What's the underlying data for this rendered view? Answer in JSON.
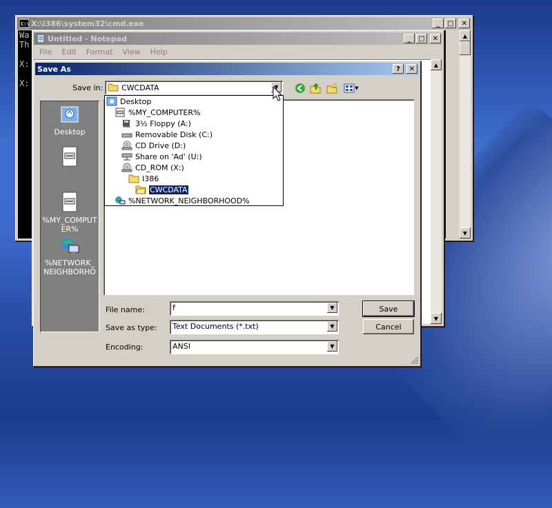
{
  "cmd": {
    "title": "X:\\i386\\system32\\cmd.exe",
    "lines": [
      "Wa",
      "Th",
      "",
      "X:",
      "",
      "X:"
    ]
  },
  "notepad": {
    "title": "Untitled - Notepad",
    "menu": [
      "File",
      "Edit",
      "Format",
      "View",
      "Help"
    ]
  },
  "saveas": {
    "title": "Save As",
    "save_in_label": "Save in:",
    "save_in_value": "CWCDATA",
    "places": [
      {
        "label": "Desktop",
        "icon": "desktop-icon"
      },
      {
        "label": "",
        "icon": "document-icon"
      },
      {
        "label": "%MY_COMPUTER%",
        "icon": "computer-icon"
      },
      {
        "label": "%NETWORK_NEIGHBORHOOD%",
        "icon": "network-icon"
      }
    ],
    "dropdown_items": [
      {
        "label": "Desktop",
        "icon": "desktop-icon"
      },
      {
        "label": "%MY_COMPUTER%",
        "icon": "computer-icon"
      },
      {
        "label": "3½ Floppy (A:)",
        "icon": "floppy-drive-icon"
      },
      {
        "label": "Removable Disk (C:)",
        "icon": "removable-disk-icon"
      },
      {
        "label": "CD Drive (D:)",
        "icon": "cd-drive-icon"
      },
      {
        "label": "Share on 'Ad' (U:)",
        "icon": "network-drive-icon"
      },
      {
        "label": "CD_ROM (X:)",
        "icon": "cd-drive-icon"
      },
      {
        "label": "I386",
        "icon": "folder-icon"
      },
      {
        "label": "CWCDATA",
        "icon": "open-folder-icon",
        "selected": true
      },
      {
        "label": "%NETWORK_NEIGHBORHOOD%",
        "icon": "network-icon"
      }
    ],
    "file_name_label": "File name:",
    "file_name_value": "f",
    "save_as_type_label": "Save as type:",
    "save_as_type_value": "Text Documents (*.txt)",
    "encoding_label": "Encoding:",
    "encoding_value": "ANSI",
    "save_button": "Save",
    "cancel_button": "Cancel"
  }
}
